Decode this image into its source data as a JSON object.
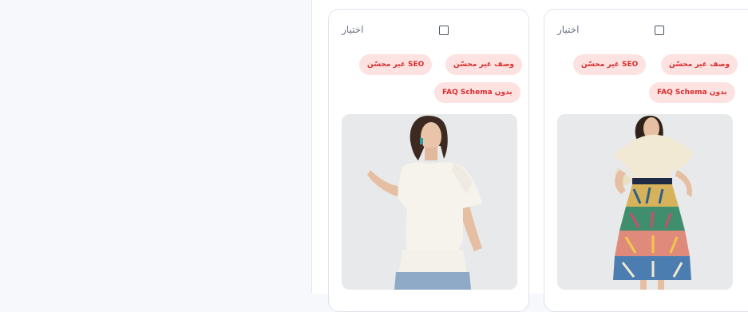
{
  "cards": [
    {
      "select_label": "اختيار",
      "badges": [
        "وصف غير محسّن",
        "SEO غير محسّن",
        "بدون FAQ Schema"
      ]
    },
    {
      "select_label": "اختيار",
      "badges": [
        "وصف غير محسّن",
        "SEO غير محسّن",
        "بدون FAQ Schema"
      ]
    }
  ],
  "colors": {
    "badge_bg": "#fde2e2",
    "badge_text": "#d92d2d",
    "page_bg": "#f6f8fb"
  }
}
